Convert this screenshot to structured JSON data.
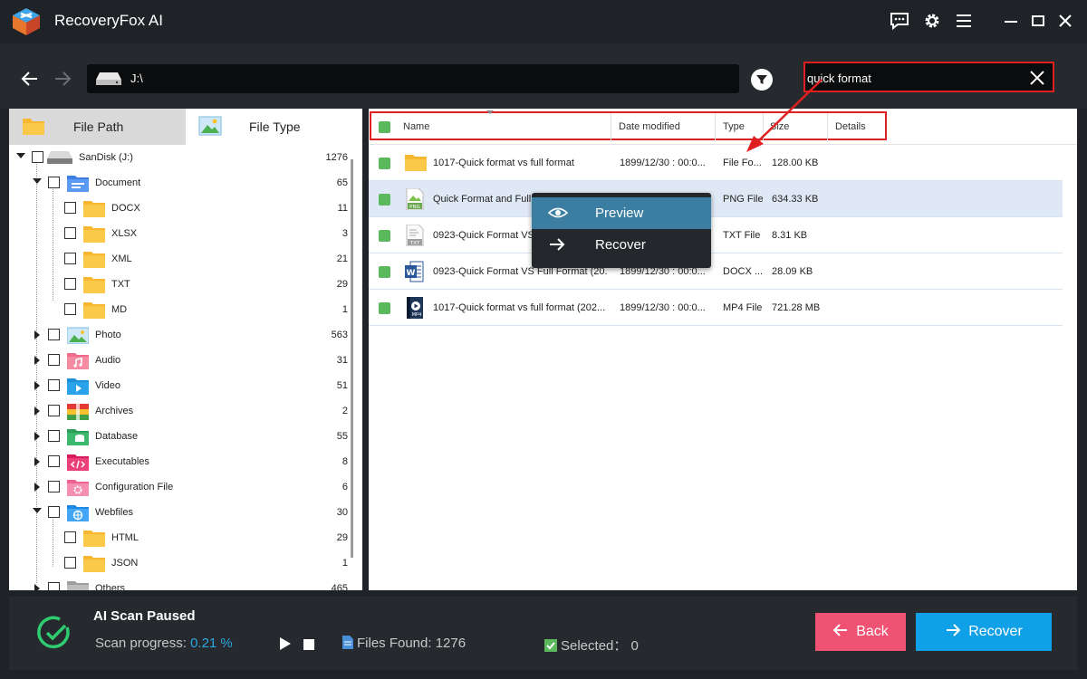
{
  "app": {
    "title": "RecoveryFox AI"
  },
  "address": {
    "path": "J:\\"
  },
  "search": {
    "value": "quick format"
  },
  "tabs": {
    "file_path": "File Path",
    "file_type": "File Type"
  },
  "tree": [
    {
      "label": "SanDisk (J:)",
      "count": "1276"
    },
    {
      "label": "Document",
      "count": "65"
    },
    {
      "label": "DOCX",
      "count": "11"
    },
    {
      "label": "XLSX",
      "count": "3"
    },
    {
      "label": "XML",
      "count": "21"
    },
    {
      "label": "TXT",
      "count": "29"
    },
    {
      "label": "MD",
      "count": "1"
    },
    {
      "label": "Photo",
      "count": "563"
    },
    {
      "label": "Audio",
      "count": "31"
    },
    {
      "label": "Video",
      "count": "51"
    },
    {
      "label": "Archives",
      "count": "2"
    },
    {
      "label": "Database",
      "count": "55"
    },
    {
      "label": "Executables",
      "count": "8"
    },
    {
      "label": "Configuration File",
      "count": "6"
    },
    {
      "label": "Webfiles",
      "count": "30"
    },
    {
      "label": "HTML",
      "count": "29"
    },
    {
      "label": "JSON",
      "count": "1"
    },
    {
      "label": "Others",
      "count": "465"
    }
  ],
  "table": {
    "headers": {
      "name": "Name",
      "date": "Date modified",
      "type": "Type",
      "size": "Size",
      "details": "Details"
    },
    "rows": [
      {
        "name": "1017-Quick format vs full format",
        "date": "1899/12/30 : 00:0...",
        "type": "File Fo...",
        "size": "128.00 KB",
        "icon": "folder-icon"
      },
      {
        "name": "Quick Format and Full F",
        "date": "",
        "type": "PNG File",
        "size": "634.33 KB",
        "icon": "png-file-icon"
      },
      {
        "name": "0923-Quick Format VS",
        "date": "",
        "type": "TXT File",
        "size": "8.31 KB",
        "icon": "txt-file-icon"
      },
      {
        "name": "0923-Quick Format VS Full Format (20...",
        "date": "1899/12/30 : 00:0...",
        "type": "DOCX ...",
        "size": "28.09 KB",
        "icon": "word-file-icon"
      },
      {
        "name": "1017-Quick format vs full format (202...",
        "date": "1899/12/30 : 00:0...",
        "type": "MP4 File",
        "size": "721.28 MB",
        "icon": "mp4-file-icon"
      }
    ]
  },
  "context_menu": {
    "preview": "Preview",
    "recover": "Recover"
  },
  "status": {
    "title": "AI Scan Paused",
    "progress_label": "Scan progress:",
    "progress_value": "0.21 %",
    "files_found": "Files Found: 1276",
    "selected": "Selected： 0"
  },
  "buttons": {
    "back": "Back",
    "recover": "Recover"
  },
  "colors": {
    "accent_blue": "#0fa0e8",
    "back_pink": "#ef5272",
    "check_green": "#5cb85c",
    "annotation_red": "#e02020"
  }
}
